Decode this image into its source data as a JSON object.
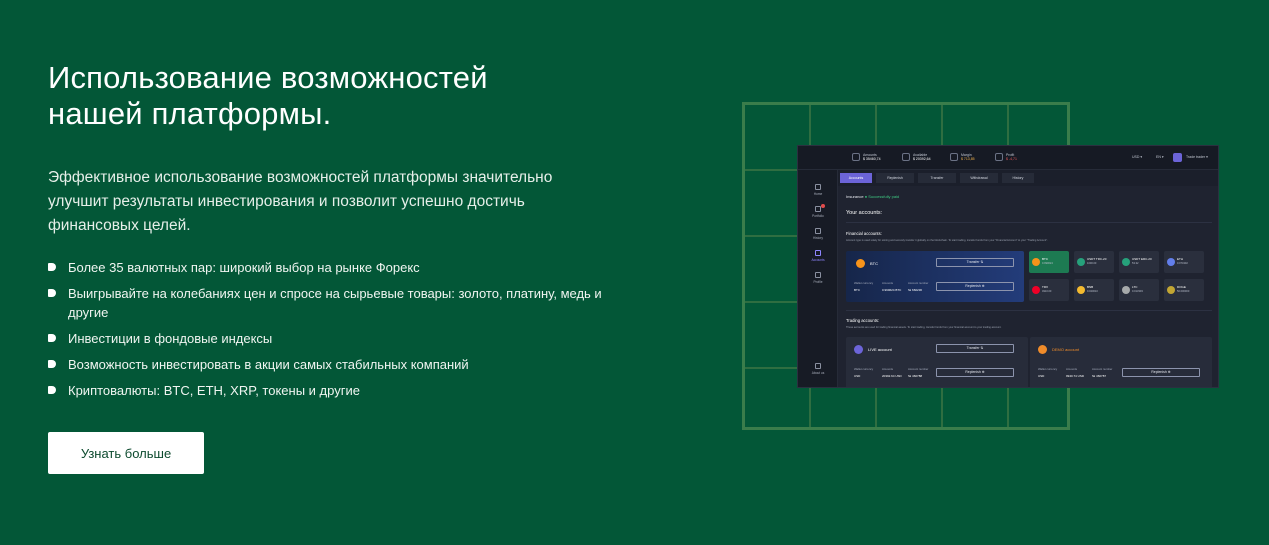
{
  "hero": {
    "title_line1": "Использование возможностей",
    "title_line2": "нашей платформы.",
    "description": "Эффективное использование возможностей платформы значительно улучшит результаты инвестирования и позволит успешно достичь финансовых целей.",
    "features": [
      "Более 35 валютных пар: широкий выбор на рынке Форекс",
      "Выигрывайте на колебаниях цен и спросе на сырьевые товары: золото, платину, медь и другие",
      "Инвестиции в фондовые индексы",
      "Возможность инвестировать в акции самых стабильных компаний",
      "Криптовалюты: BTC, ETH, XRP, токены и другие"
    ],
    "cta_label": "Узнать больше"
  },
  "app": {
    "stats": [
      {
        "label": "Amounts",
        "value": "$ 35460,74",
        "tone": "normal"
      },
      {
        "label": "Available",
        "value": "$ 20392,64",
        "tone": "normal"
      },
      {
        "label": "Margin",
        "value": "$ 713,85",
        "tone": "up"
      },
      {
        "label": "Profit",
        "value": "$ -4,71",
        "tone": "dn"
      }
    ],
    "currency": "USD",
    "language": "EN",
    "user": "Trade trader",
    "sidebar": [
      "Home",
      "Portfolio",
      "History",
      "Accounts",
      "Profile",
      "About us"
    ],
    "tabs": [
      "Accounts",
      "Replenish",
      "Transfer",
      "Withdrawal",
      "History"
    ],
    "insurance_label": "Insurance",
    "insurance_status": "Successfully paid",
    "your_accounts": "Your accounts:",
    "financial_title": "Financial accounts:",
    "financial_desc": "Account type is used solely for storing and securely transfer it globally on the blockchain. To start trading, transfer funds from your \"Financial Account\" to your \"Trading Account\".",
    "btc_card": {
      "name": "BTC",
      "transfer": "Transfer",
      "replenish": "Replenish",
      "wallet_currency_label": "Wallet currency",
      "wallet_currency": "BTC",
      "amounts_label": "Amounts",
      "amounts": "0.999624 BTC",
      "account_number_label": "Account number",
      "account_number": "№ 660230"
    },
    "coins": [
      {
        "name": "BTC",
        "value": "0.999624",
        "color": "#f7931a",
        "selected": true
      },
      {
        "name": "USDT TRC-20",
        "value": "1000.00",
        "color": "#26a17b",
        "selected": false
      },
      {
        "name": "USDT ERC-20",
        "value": "53.32",
        "color": "#26a17b",
        "selected": false
      },
      {
        "name": "ETH",
        "value": "0.074302",
        "color": "#627eea",
        "selected": false
      },
      {
        "name": "TRX",
        "value": "4910.00",
        "color": "#ef0027",
        "selected": false
      },
      {
        "name": "BNB",
        "value": "0.020010",
        "color": "#f3ba2f",
        "selected": false
      },
      {
        "name": "LTC",
        "value": "0.013303",
        "color": "#a6a9aa",
        "selected": false
      },
      {
        "name": "DOGE",
        "value": "50.000000",
        "color": "#c2a633",
        "selected": false
      }
    ],
    "trading_title": "Trading accounts:",
    "trading_desc": "These accounts are used for trading financial assets. To start trading, transfer funds from your financial account to your trading account.",
    "live": {
      "name": "LIVE account",
      "transfer": "Transfer",
      "replenish": "Replenish",
      "wallet_currency": "USD",
      "amounts": "20392.64 USD",
      "account_number": "№ 460788"
    },
    "demo": {
      "name": "DEMO account",
      "replenish": "Replenish",
      "wallet_currency": "USD",
      "amounts": "9940.74 USD",
      "account_number": "№ 460787"
    }
  }
}
